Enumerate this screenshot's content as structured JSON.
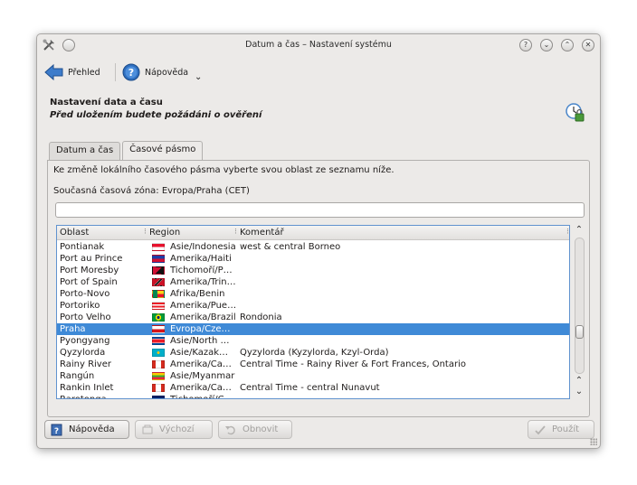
{
  "window": {
    "title": "Datum a čas – Nastavení systému"
  },
  "titlebar_buttons": {
    "help": "?",
    "minimize": "⌄",
    "maximize": "⌃",
    "close": "✕"
  },
  "toolbar": {
    "overview_label": "Přehled",
    "help_label": "Nápověda",
    "help_menu_arrow": "⌄"
  },
  "header": {
    "title": "Nastavení data a času",
    "subtitle": "Před uložením budete požádáni o ověření"
  },
  "tabs": [
    {
      "label": "Datum a čas",
      "active": false
    },
    {
      "label": "Časové pásmo",
      "active": true
    }
  ],
  "timezone": {
    "instruction": "Ke změně lokálního časového pásma vyberte svou oblast ze seznamu níže.",
    "current_zone": "Současná časová zóna: Evropa/Praha (CET)",
    "search_value": "",
    "columns": [
      "Oblast",
      "Region",
      "Komentář"
    ],
    "rows": [
      {
        "area": "Pontianak",
        "region": "Asie/Indonesia",
        "comment": "west & central Borneo",
        "flag": "indonesia"
      },
      {
        "area": "Port au Prince",
        "region": "Amerika/Haiti",
        "comment": "",
        "flag": "haiti"
      },
      {
        "area": "Port Moresby",
        "region": "Tichomoří/P…",
        "comment": "",
        "flag": "papua-new-guinea"
      },
      {
        "area": "Port of Spain",
        "region": "Amerika/Trin…",
        "comment": "",
        "flag": "trinidad"
      },
      {
        "area": "Porto-Novo",
        "region": "Afrika/Benin",
        "comment": "",
        "flag": "benin"
      },
      {
        "area": "Portoriko",
        "region": "Amerika/Pue…",
        "comment": "",
        "flag": "puerto-rico"
      },
      {
        "area": "Porto Velho",
        "region": "Amerika/Brazil",
        "comment": "Rondonia",
        "flag": "brazil"
      },
      {
        "area": "Praha",
        "region": "Evropa/Cze…",
        "comment": "",
        "flag": "czech",
        "selected": true
      },
      {
        "area": "Pyongyang",
        "region": "Asie/North …",
        "comment": "",
        "flag": "north-korea"
      },
      {
        "area": "Qyzylorda",
        "region": "Asie/Kazak…",
        "comment": "Qyzylorda (Kyzylorda, Kzyl-Orda)",
        "flag": "kazakhstan"
      },
      {
        "area": "Rainy River",
        "region": "Amerika/Ca…",
        "comment": "Central Time - Rainy River & Fort Frances, Ontario",
        "flag": "canada"
      },
      {
        "area": "Rangún",
        "region": "Asie/Myanmar",
        "comment": "",
        "flag": "myanmar"
      },
      {
        "area": "Rankin Inlet",
        "region": "Amerika/Ca…",
        "comment": "Central Time - central Nunavut",
        "flag": "canada"
      },
      {
        "area": "Rarotonga",
        "region": "Tichomoří/C…",
        "comment": "",
        "flag": "cook-islands"
      }
    ],
    "scroll_up": "⌃",
    "scroll_down": "⌄",
    "scroll_corner_up": "⌃",
    "scroll_corner_down": "⌄"
  },
  "buttons": {
    "help": "Nápověda",
    "defaults": "Výchozí",
    "reset": "Obnovit",
    "apply": "Použít"
  },
  "colors": {
    "selection": "#3f8ad7",
    "list_border": "#6193cf"
  }
}
